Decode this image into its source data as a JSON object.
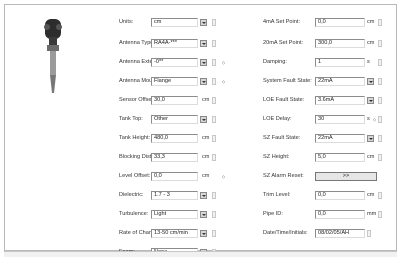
{
  "left": {
    "units": {
      "label": "Units:",
      "value": "cm"
    },
    "antenna_type": {
      "label": "Antenna Type:",
      "value": "RA4A-***"
    },
    "antenna_extension": {
      "label": "Antenna Extension:",
      "value": "-0**"
    },
    "antenna_mount": {
      "label": "Antenna Mount:",
      "value": "Flange"
    },
    "sensor_offset": {
      "label": "Sensor Offset:",
      "value": "30,0",
      "unit": "cm"
    },
    "tank_top": {
      "label": "Tank Top:",
      "value": "Other"
    },
    "tank_height": {
      "label": "Tank Height:",
      "value": "480,0",
      "unit": "cm"
    },
    "blocking_distance": {
      "label": "Blocking Distance:",
      "value": "33,3",
      "unit": "cm"
    },
    "level_offset": {
      "label": "Level Offset:",
      "value": "0,0",
      "unit": "cm"
    },
    "dielectric": {
      "label": "Dielectric:",
      "value": "1.7 - 3"
    },
    "turbulence": {
      "label": "Turbulence:",
      "value": "Light"
    },
    "rate_of_change": {
      "label": "Rate of Change:",
      "value": "13-50  cm/min"
    },
    "foam": {
      "label": "Foam:",
      "value": "None"
    }
  },
  "right": {
    "set_point_4ma": {
      "label": "4mA Set Point:",
      "value": "0,0",
      "unit": "cm"
    },
    "set_point_20ma": {
      "label": "20mA Set Point:",
      "value": "300,0",
      "unit": "cm"
    },
    "damping": {
      "label": "Damping:",
      "value": "1",
      "unit": "s"
    },
    "system_fault_state": {
      "label": "System Fault State:",
      "value": "22mA"
    },
    "loe_fault_state": {
      "label": "LOE Fault State:",
      "value": "3.6mA"
    },
    "loe_delay": {
      "label": "LOE Delay:",
      "value": "30",
      "unit": "s"
    },
    "sz_fault_state": {
      "label": "SZ Fault State:",
      "value": "22mA"
    },
    "sz_height": {
      "label": "SZ Height:",
      "value": "5,0",
      "unit": "cm"
    },
    "sz_alarm_reset": {
      "label": "SZ Alarm Reset:",
      "button": ">>"
    },
    "trim_level": {
      "label": "Trim Level:",
      "value": "0,0",
      "unit": "cm"
    },
    "pipe_id": {
      "label": "Pipe ID:",
      "value": "0,0",
      "unit": "mm"
    },
    "date_time_initials": {
      "label": "Date/Time/Initials:",
      "value": "08/02/05/AH"
    }
  },
  "icons": {
    "probe": "radar-probe-icon",
    "dropdown": "chevron-down-icon"
  }
}
